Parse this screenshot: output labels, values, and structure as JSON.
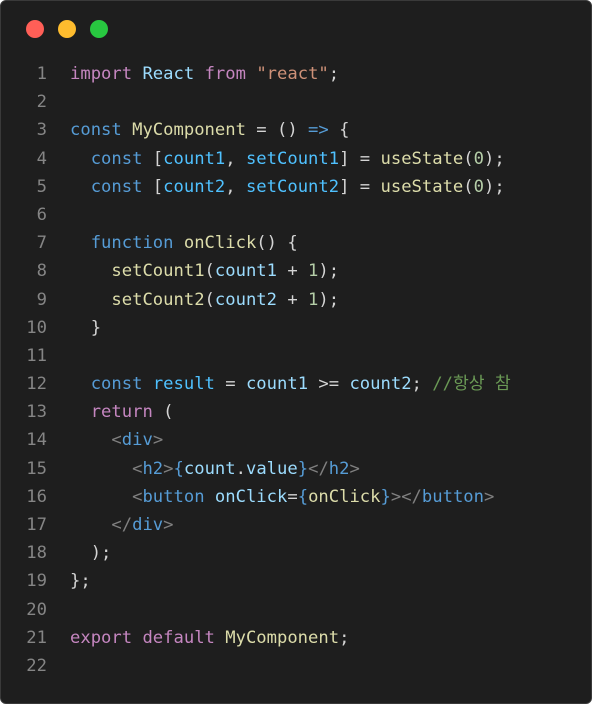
{
  "window": {
    "buttons": [
      "close",
      "minimize",
      "zoom"
    ]
  },
  "code": {
    "lines": [
      {
        "n": "1",
        "tokens": [
          [
            "control",
            "import"
          ],
          [
            "plain",
            " "
          ],
          [
            "var",
            "React"
          ],
          [
            "plain",
            " "
          ],
          [
            "control",
            "from"
          ],
          [
            "plain",
            " "
          ],
          [
            "string",
            "\"react\""
          ],
          [
            "plain",
            ";"
          ]
        ]
      },
      {
        "n": "2",
        "tokens": []
      },
      {
        "n": "3",
        "tokens": [
          [
            "keyword",
            "const"
          ],
          [
            "plain",
            " "
          ],
          [
            "func",
            "MyComponent"
          ],
          [
            "plain",
            " = () "
          ],
          [
            "keyword",
            "=>"
          ],
          [
            "plain",
            " {"
          ]
        ]
      },
      {
        "n": "4",
        "tokens": [
          [
            "plain",
            "  "
          ],
          [
            "keyword",
            "const"
          ],
          [
            "plain",
            " ["
          ],
          [
            "const",
            "count1"
          ],
          [
            "plain",
            ", "
          ],
          [
            "const",
            "setCount1"
          ],
          [
            "plain",
            "] = "
          ],
          [
            "func",
            "useState"
          ],
          [
            "plain",
            "("
          ],
          [
            "number",
            "0"
          ],
          [
            "plain",
            ");"
          ]
        ]
      },
      {
        "n": "5",
        "tokens": [
          [
            "plain",
            "  "
          ],
          [
            "keyword",
            "const"
          ],
          [
            "plain",
            " ["
          ],
          [
            "const",
            "count2"
          ],
          [
            "plain",
            ", "
          ],
          [
            "const",
            "setCount2"
          ],
          [
            "plain",
            "] = "
          ],
          [
            "func",
            "useState"
          ],
          [
            "plain",
            "("
          ],
          [
            "number",
            "0"
          ],
          [
            "plain",
            ");"
          ]
        ]
      },
      {
        "n": "6",
        "tokens": []
      },
      {
        "n": "7",
        "tokens": [
          [
            "plain",
            "  "
          ],
          [
            "keyword",
            "function"
          ],
          [
            "plain",
            " "
          ],
          [
            "func",
            "onClick"
          ],
          [
            "plain",
            "() {"
          ]
        ]
      },
      {
        "n": "8",
        "tokens": [
          [
            "plain",
            "    "
          ],
          [
            "func",
            "setCount1"
          ],
          [
            "plain",
            "("
          ],
          [
            "var",
            "count1"
          ],
          [
            "plain",
            " + "
          ],
          [
            "number",
            "1"
          ],
          [
            "plain",
            ");"
          ]
        ]
      },
      {
        "n": "9",
        "tokens": [
          [
            "plain",
            "    "
          ],
          [
            "func",
            "setCount2"
          ],
          [
            "plain",
            "("
          ],
          [
            "var",
            "count2"
          ],
          [
            "plain",
            " + "
          ],
          [
            "number",
            "1"
          ],
          [
            "plain",
            ");"
          ]
        ]
      },
      {
        "n": "10",
        "tokens": [
          [
            "plain",
            "  }"
          ]
        ]
      },
      {
        "n": "11",
        "tokens": []
      },
      {
        "n": "12",
        "tokens": [
          [
            "plain",
            "  "
          ],
          [
            "keyword",
            "const"
          ],
          [
            "plain",
            " "
          ],
          [
            "const",
            "result"
          ],
          [
            "plain",
            " = "
          ],
          [
            "var",
            "count1"
          ],
          [
            "plain",
            " >= "
          ],
          [
            "var",
            "count2"
          ],
          [
            "plain",
            "; "
          ],
          [
            "comment",
            "//항상 참"
          ]
        ]
      },
      {
        "n": "13",
        "tokens": [
          [
            "plain",
            "  "
          ],
          [
            "control",
            "return"
          ],
          [
            "plain",
            " ("
          ]
        ]
      },
      {
        "n": "14",
        "tokens": [
          [
            "plain",
            "    "
          ],
          [
            "bracket",
            "<"
          ],
          [
            "tag",
            "div"
          ],
          [
            "bracket",
            ">"
          ]
        ]
      },
      {
        "n": "15",
        "tokens": [
          [
            "plain",
            "      "
          ],
          [
            "bracket",
            "<"
          ],
          [
            "tag",
            "h2"
          ],
          [
            "bracket",
            ">"
          ],
          [
            "keyword",
            "{"
          ],
          [
            "var",
            "count"
          ],
          [
            "plain",
            "."
          ],
          [
            "var",
            "value"
          ],
          [
            "keyword",
            "}"
          ],
          [
            "bracket",
            "</"
          ],
          [
            "tag",
            "h2"
          ],
          [
            "bracket",
            ">"
          ]
        ]
      },
      {
        "n": "16",
        "tokens": [
          [
            "plain",
            "      "
          ],
          [
            "bracket",
            "<"
          ],
          [
            "tag",
            "button"
          ],
          [
            "plain",
            " "
          ],
          [
            "var",
            "onClick"
          ],
          [
            "plain",
            "="
          ],
          [
            "keyword",
            "{"
          ],
          [
            "func",
            "onClick"
          ],
          [
            "keyword",
            "}"
          ],
          [
            "bracket",
            "></"
          ],
          [
            "tag",
            "button"
          ],
          [
            "bracket",
            ">"
          ]
        ]
      },
      {
        "n": "17",
        "tokens": [
          [
            "plain",
            "    "
          ],
          [
            "bracket",
            "</"
          ],
          [
            "tag",
            "div"
          ],
          [
            "bracket",
            ">"
          ]
        ]
      },
      {
        "n": "18",
        "tokens": [
          [
            "plain",
            "  );"
          ]
        ]
      },
      {
        "n": "19",
        "tokens": [
          [
            "plain",
            "};"
          ]
        ]
      },
      {
        "n": "20",
        "tokens": []
      },
      {
        "n": "21",
        "tokens": [
          [
            "control",
            "export"
          ],
          [
            "plain",
            " "
          ],
          [
            "control",
            "default"
          ],
          [
            "plain",
            " "
          ],
          [
            "func",
            "MyComponent"
          ],
          [
            "plain",
            ";"
          ]
        ]
      },
      {
        "n": "22",
        "tokens": []
      }
    ]
  },
  "colors": {
    "background": "#1e1e1e",
    "close": "#ff5f57",
    "minimize": "#febc2e",
    "zoom": "#28c840"
  }
}
